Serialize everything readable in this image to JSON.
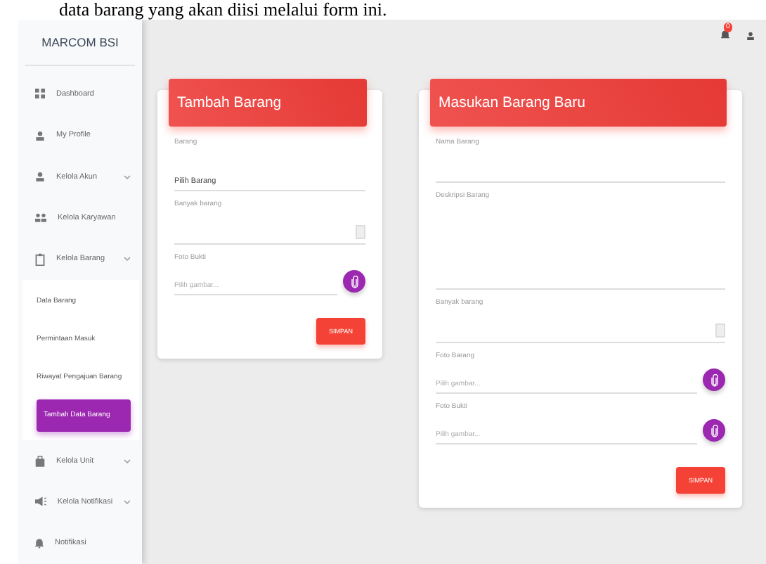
{
  "caption": "data barang yang akan diisi melalui form ini.",
  "brand": "MARCOM BSI",
  "topbar": {
    "notification_count": "0"
  },
  "sidebar": {
    "items": [
      {
        "kind": "link",
        "label": "Dashboard"
      },
      {
        "kind": "link",
        "label": "My Profile"
      },
      {
        "kind": "group",
        "label": "Kelola Akun"
      },
      {
        "kind": "link",
        "label": "Kelola Karyawan"
      },
      {
        "kind": "group",
        "label": "Kelola Barang",
        "expanded": true,
        "children": [
          {
            "label": "Data Barang",
            "selected": false
          },
          {
            "label": "Permintaan Masuk",
            "selected": false
          },
          {
            "label": "Riwayat Pengajuan Barang",
            "selected": false
          },
          {
            "label": "Tambah Data Barang",
            "selected": true
          }
        ]
      },
      {
        "kind": "group",
        "label": "Kelola Unit"
      },
      {
        "kind": "group",
        "label": "Kelola Notifikasi"
      },
      {
        "kind": "link",
        "label": "Notifikasi"
      }
    ]
  },
  "cards": [
    {
      "title": "Tambah Barang",
      "fields": [
        {
          "kind": "select",
          "label": "Barang",
          "value": "Pilih Barang"
        },
        {
          "kind": "number",
          "label": "Banyak barang"
        },
        {
          "kind": "file",
          "label": "Foto Bukti",
          "placeholder": "Pilih gambar..."
        }
      ],
      "button": "SIMPAN"
    },
    {
      "title": "Masukan Barang Baru",
      "fields": [
        {
          "kind": "text",
          "label": "Nama Barang"
        },
        {
          "kind": "textarea",
          "label": "Deskripsi Barang"
        },
        {
          "kind": "number",
          "label": "Banyak barang"
        },
        {
          "kind": "file",
          "label": "Foto Barang",
          "placeholder": "Pilih gambar..."
        },
        {
          "kind": "file",
          "label": "Foto Bukti",
          "placeholder": "Pilih gambar..."
        }
      ],
      "button": "SIMPAN"
    }
  ]
}
